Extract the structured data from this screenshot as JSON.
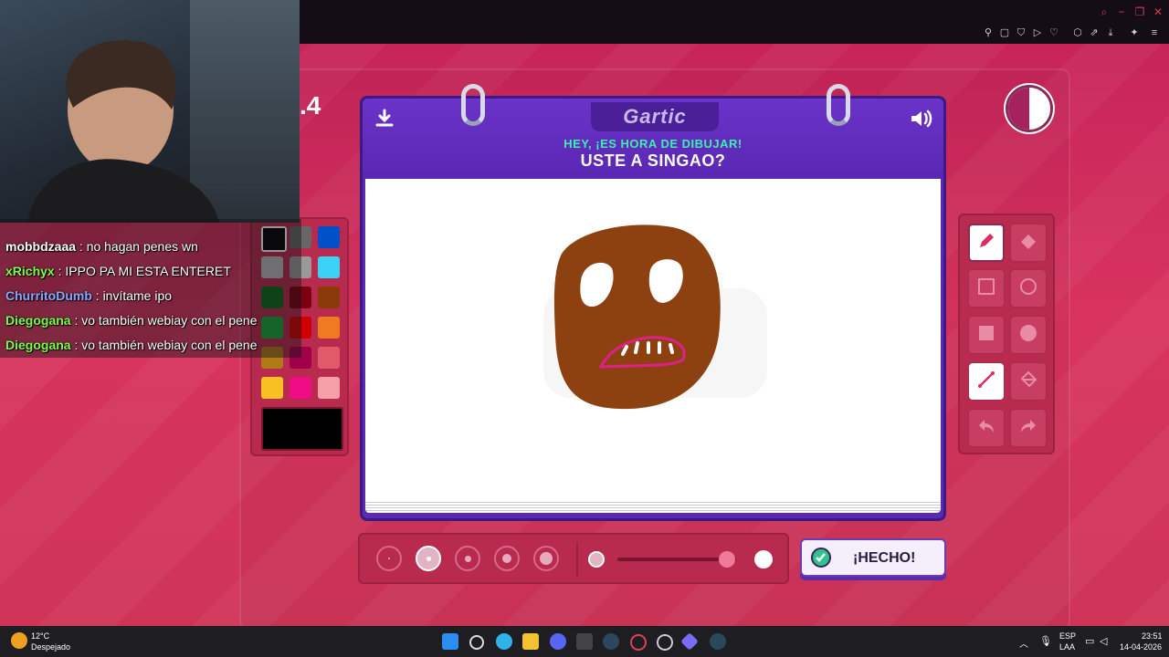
{
  "browser": {
    "window_controls": [
      "−",
      "❐",
      "✕"
    ]
  },
  "stream": {
    "round_fragment": ".4",
    "chat": [
      {
        "user": "mobbdzaaa",
        "message": "no hagan penes wn",
        "color": "#ffffff"
      },
      {
        "user": "xRichyx",
        "message": "IPPO PA MI ESTA ENTERET",
        "color": "#7cfc4a"
      },
      {
        "user": "ChurritoDumb",
        "message": "invítame ipo",
        "color": "#8aa8ff"
      },
      {
        "user": "Diegogana",
        "message": "vo también webiay con el pene",
        "color": "#7cfc4a"
      },
      {
        "user": "Diegogana",
        "message": "vo también webiay con el pene",
        "color": "#7cfc4a"
      }
    ]
  },
  "game": {
    "logo": "Gartic",
    "subtitle": "HEY, ¡ES HORA DE DIBUJAR!",
    "word": "USTE A SINGAO?",
    "done_label": "¡HECHO!",
    "timer_progress": 0.5,
    "palette": [
      "#000000",
      "#666666",
      "#0050c8",
      "#bbbbbb",
      "#999999",
      "#3cd2f5",
      "#0a6b1c",
      "#7a0010",
      "#8b3a0a",
      "#18a83a",
      "#d00000",
      "#f07a20",
      "#b07a18",
      "#a0004a",
      "#e05a6a",
      "#f8c020",
      "#f00c84",
      "#f5a0a8"
    ],
    "selected_color": "#000000",
    "tools": [
      "pencil-icon",
      "eraser-icon",
      "rectangle-outline-icon",
      "ellipse-outline-icon",
      "rectangle-fill-icon",
      "ellipse-fill-icon",
      "line-icon",
      "fill-bucket-icon",
      "undo-icon",
      "redo-icon"
    ],
    "active_tool": "pencil-icon",
    "brush_sizes_selected_index": 1,
    "opacity_level": 0.92,
    "accent": "#c7245a",
    "card_color": "#5a2ab0",
    "highlight_color": "#3df0ae"
  },
  "taskbar": {
    "weather_temp": "12°C",
    "weather_desc": "Despejado",
    "lang_top": "ESP",
    "lang_bottom": "LAA",
    "time": "23:51",
    "date": "14-04-2026"
  }
}
